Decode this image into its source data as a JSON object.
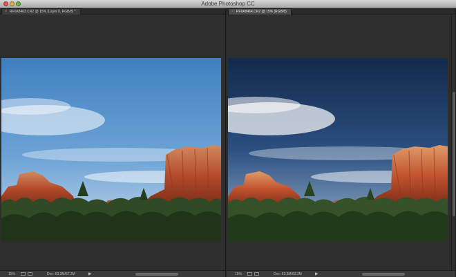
{
  "window": {
    "title": "Adobe Photoshop CC"
  },
  "documents": [
    {
      "tab_label": "RF0A8463.CR2 @ 15% (Layer 0, RGB/8) *",
      "zoom": "15%",
      "doc_info": "Doc: 63.3M/67.3M"
    },
    {
      "tab_label": "RF0A8464.CR2 @ 15% (RGB/8)",
      "zoom": "15%",
      "doc_info": "Doc: 63.3M/63.3M"
    }
  ],
  "icons": {
    "close": "close-icon",
    "minimize": "minimize-icon",
    "zoom": "zoom-icon",
    "status_arrow": "play-arrow-icon"
  },
  "colors": {
    "titlebar": "#c0c0c0",
    "workspace": "#262626",
    "panel": "#353535",
    "sky_left": "#4c8ac4",
    "sky_right": "#1f3f6a",
    "rock": "#b44a2a"
  }
}
